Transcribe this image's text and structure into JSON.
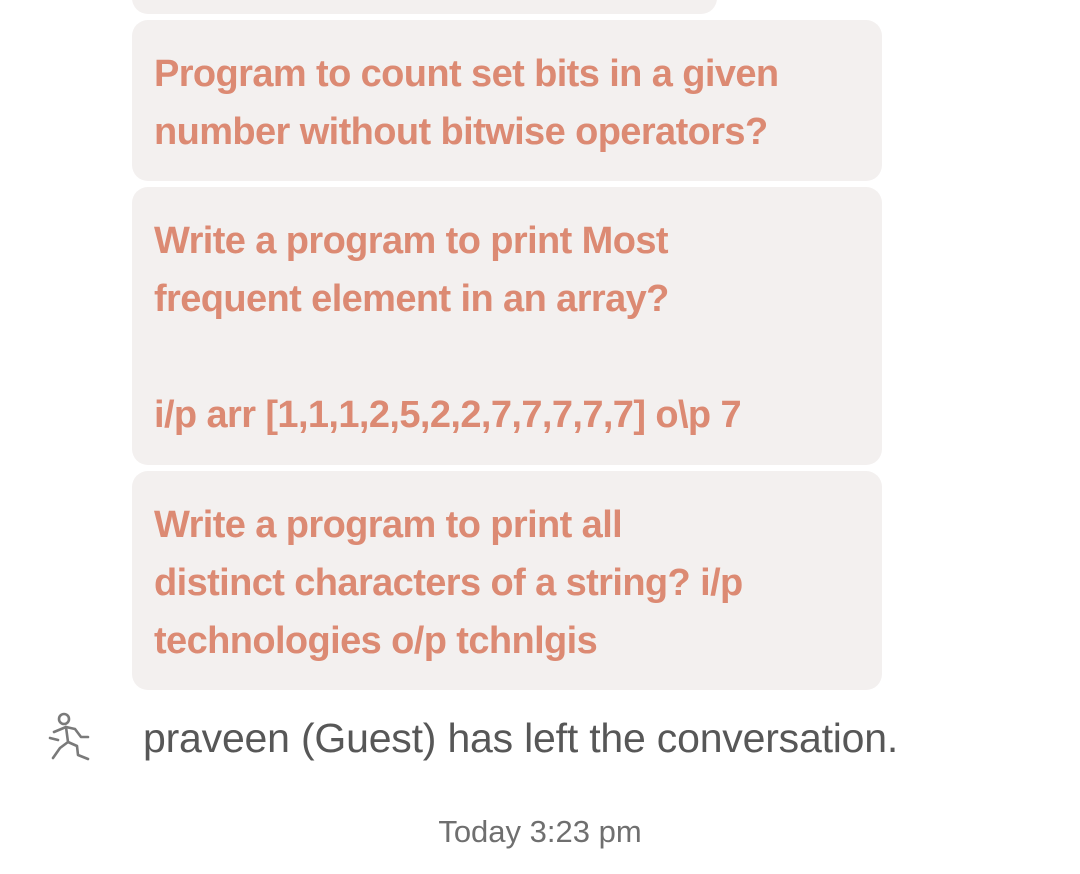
{
  "messages": [
    {
      "text": "Program to count set bits in a given\nnumber without bitwise operators?"
    },
    {
      "text": "Write a program to print Most\nfrequent element in an array?\n\ni/p arr [1,1,1,2,5,2,2,7,7,7,7,7] o\\p 7"
    },
    {
      "text": "Write a program to print all\ndistinct characters of a string? i/p\ntechnologies o/p tchnlgis"
    }
  ],
  "system_notice": {
    "icon": "person-leaving-icon",
    "text": "praveen (Guest) has left the conversation."
  },
  "timestamp": "Today 3:23 pm",
  "colors": {
    "bubble_background": "#f3f0ef",
    "message_text": "#dc8a73",
    "system_text": "#575757",
    "timestamp_text": "#6f6f6f"
  }
}
